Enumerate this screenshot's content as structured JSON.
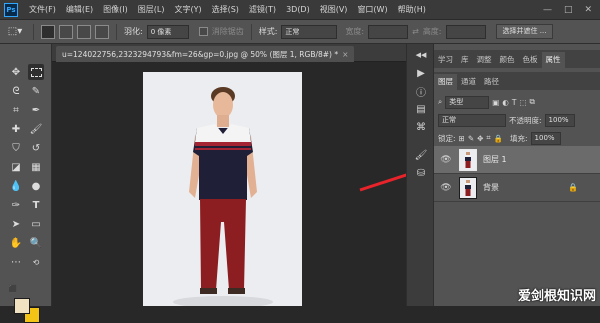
{
  "app": {
    "logo": "Ps"
  },
  "menu": [
    "文件(F)",
    "编辑(E)",
    "图像(I)",
    "图层(L)",
    "文字(Y)",
    "选择(S)",
    "滤镜(T)",
    "3D(D)",
    "视图(V)",
    "窗口(W)",
    "帮助(H)"
  ],
  "window_controls": [
    "—",
    "□",
    "✕"
  ],
  "options": {
    "feather_label": "羽化:",
    "feather_value": "0 像素",
    "antialias_label": "消除锯齿",
    "style_label": "样式:",
    "style_value": "正常",
    "width_label": "宽度:",
    "height_label": "高度:",
    "select_mask_button": "选择并遮住 ..."
  },
  "document": {
    "tab_title": "u=124022756,2323294793&fm=26&gp=0.jpg @ 50% (图层 1, RGB/8#) *",
    "close": "×"
  },
  "panels": {
    "top_tabs": [
      "学习",
      "库",
      "调整",
      "颜色",
      "色板",
      "属性"
    ],
    "top_active_index": 5,
    "layer_tabs": [
      "图层",
      "通道",
      "路径"
    ],
    "layer_active_index": 0,
    "filter_kind": "类型",
    "blend_mode": "正常",
    "opacity_label": "不透明度:",
    "opacity_value": "100%",
    "lock_label": "锁定:",
    "fill_label": "填充:",
    "fill_value": "100%",
    "layers": [
      {
        "name": "图层 1",
        "visible": true,
        "selected": true,
        "locked": false
      },
      {
        "name": "背景",
        "visible": true,
        "selected": false,
        "locked": true
      }
    ]
  },
  "colors": {
    "foreground": "#f1e3c2",
    "background": "#f3c316",
    "arrow": "#e8232a",
    "shirt_white": "#f4f4f4",
    "shirt_navy": "#1f2038",
    "stripe_red": "#a52433",
    "pants": "#8c1e22"
  },
  "icons": {
    "eye": "eye-icon",
    "lock": "lock-icon"
  },
  "watermark": "爱剑根知识网"
}
